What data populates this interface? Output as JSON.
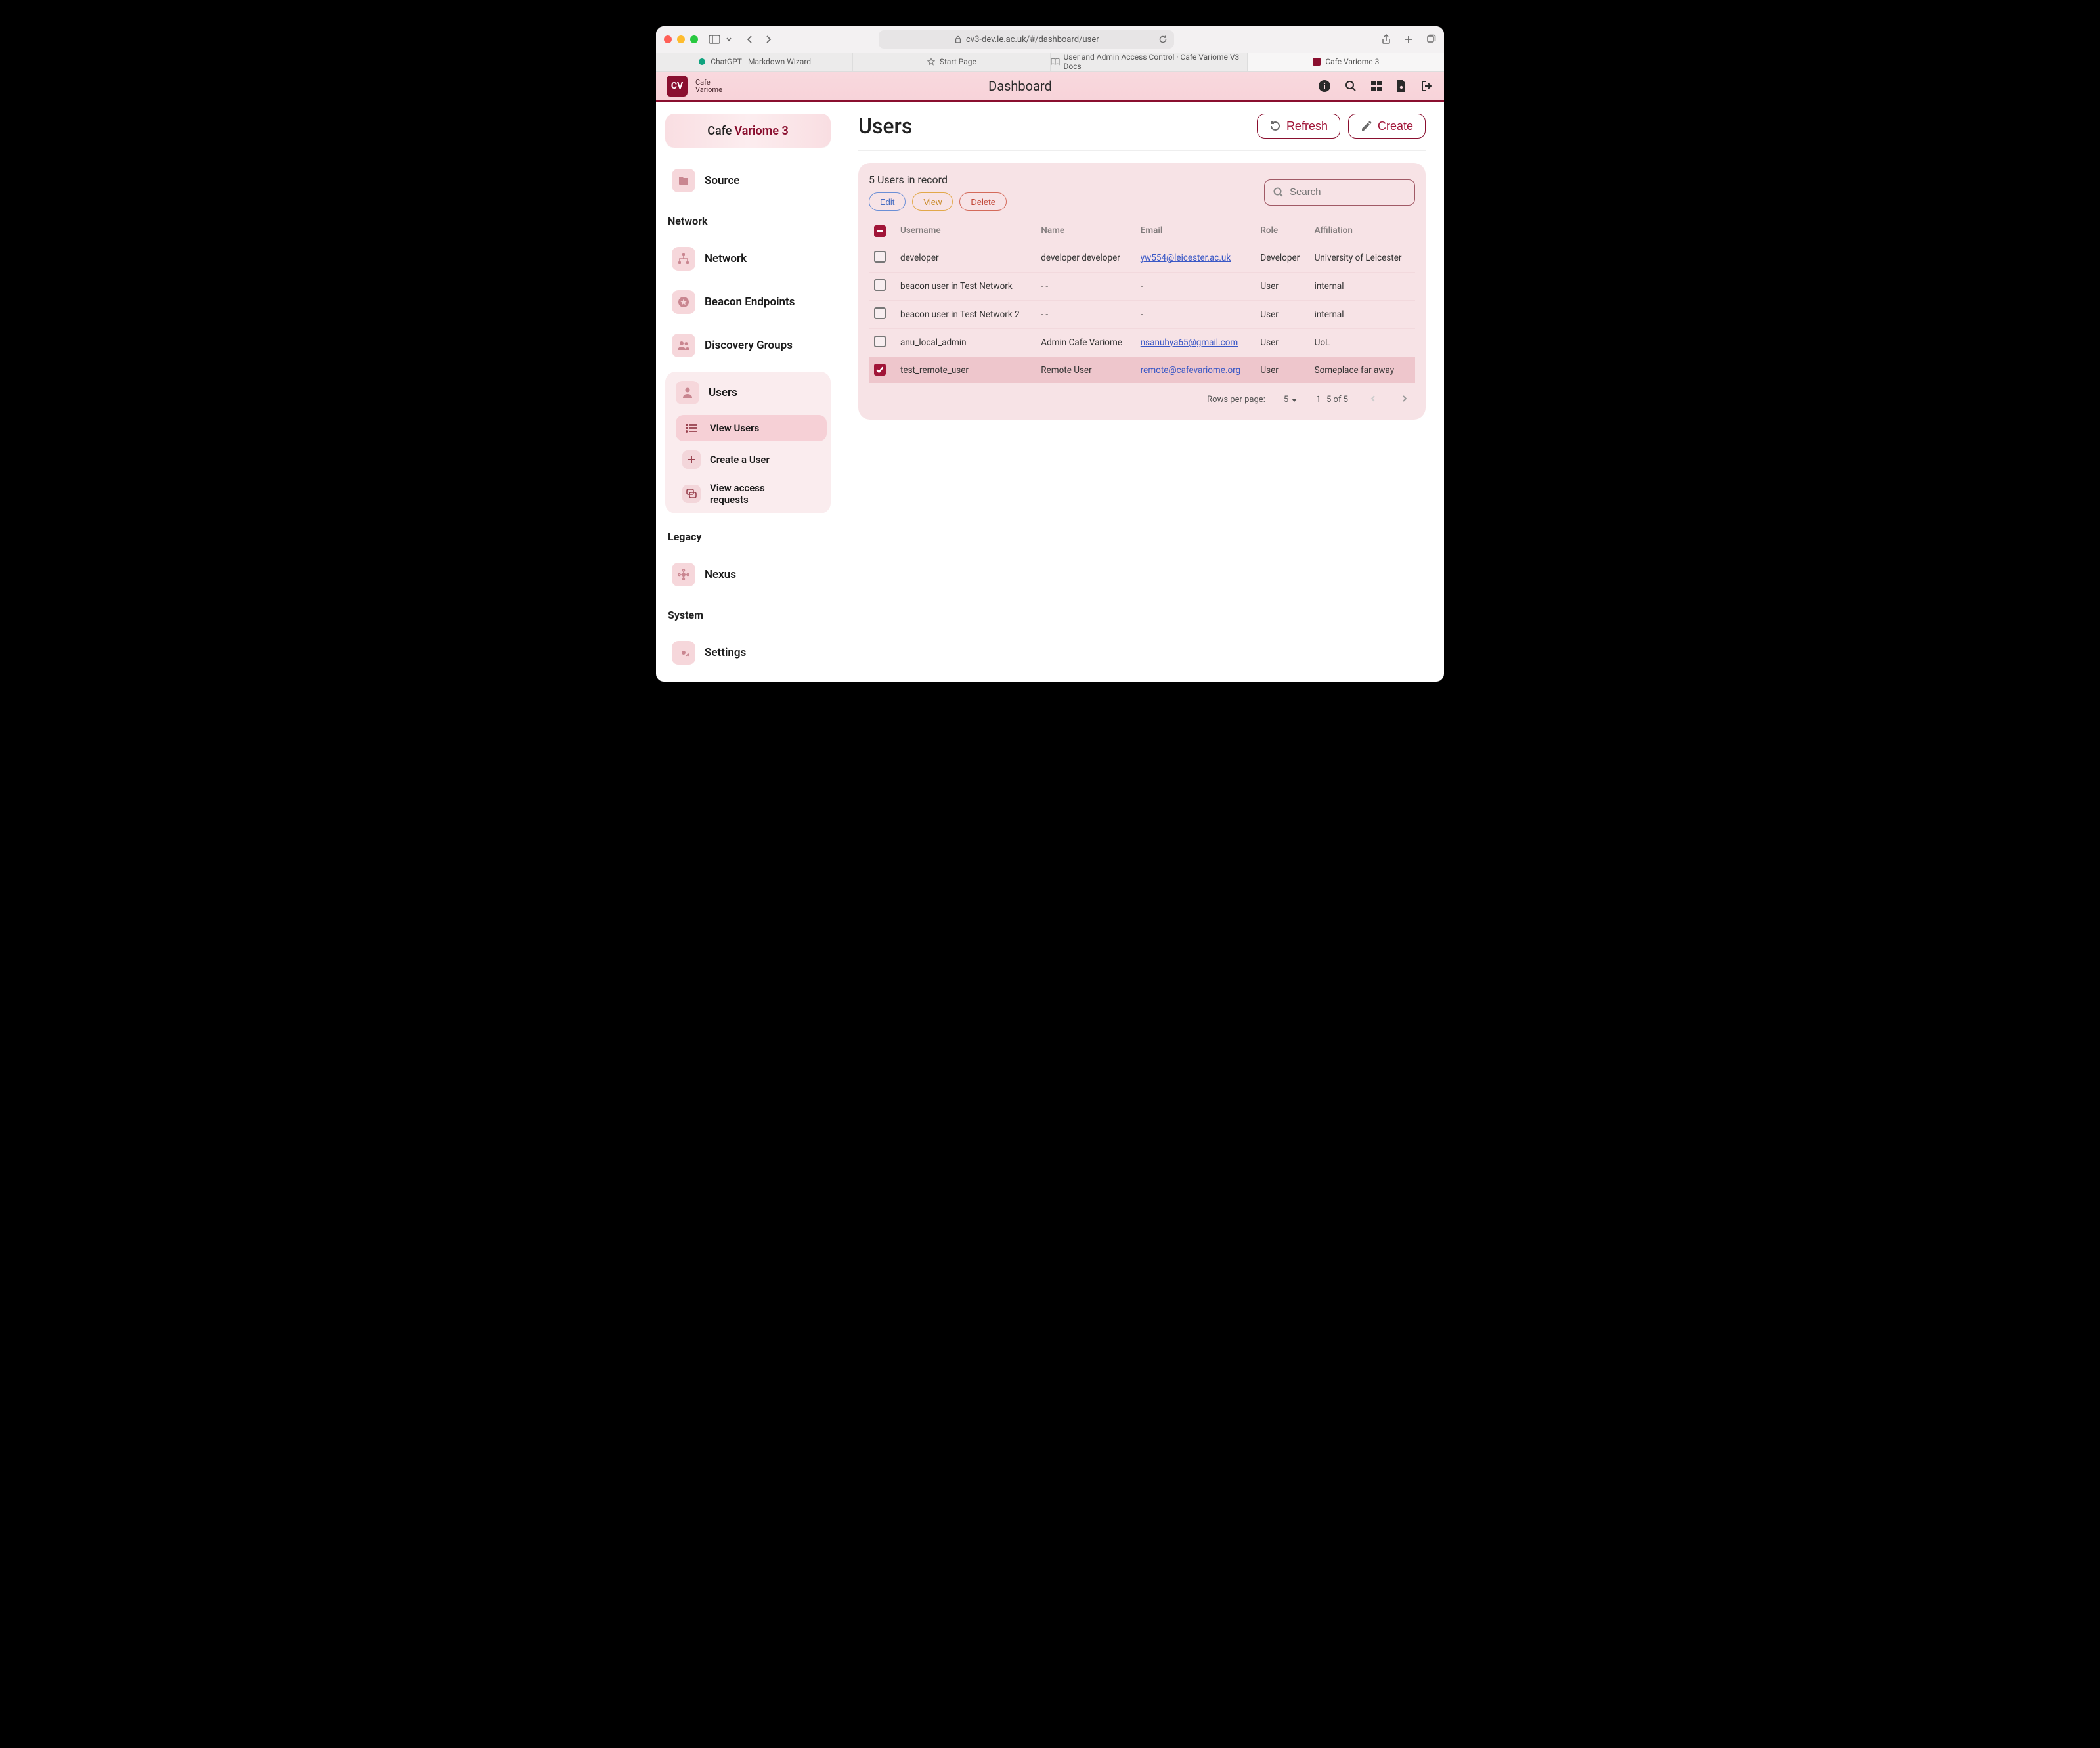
{
  "browser": {
    "url": "cv3-dev.le.ac.uk/#/dashboard/user",
    "tabs": [
      {
        "label": "ChatGPT - Markdown Wizard",
        "active": false
      },
      {
        "label": "Start Page",
        "active": false
      },
      {
        "label": "User and Admin Access Control · Cafe Variome V3 Docs",
        "active": false
      },
      {
        "label": "Cafe Variome 3",
        "active": true
      }
    ]
  },
  "header": {
    "logo_badge": "CV",
    "logo_line1": "Cafe",
    "logo_line2": "Variome",
    "title": "Dashboard"
  },
  "sidebar": {
    "brand_word1": "Cafe",
    "brand_word2": "Variome 3",
    "items": {
      "source": "Source",
      "network_section": "Network",
      "network": "Network",
      "beacon": "Beacon Endpoints",
      "discovery": "Discovery Groups",
      "users": "Users",
      "users_sub": {
        "view": "View Users",
        "create": "Create a User",
        "requests": "View access requests"
      },
      "legacy_section": "Legacy",
      "nexus": "Nexus",
      "system_section": "System",
      "settings": "Settings"
    }
  },
  "main": {
    "title": "Users",
    "refresh": "Refresh",
    "create": "Create",
    "record_count": "5 Users in record",
    "pills": {
      "edit": "Edit",
      "view": "View",
      "delete": "Delete"
    },
    "search_placeholder": "Search",
    "columns": [
      "Username",
      "Name",
      "Email",
      "Role",
      "Affiliation"
    ],
    "rows": [
      {
        "selected": false,
        "username": "developer",
        "name": "developer developer",
        "email": "yw554@leicester.ac.uk",
        "role": "Developer",
        "affiliation": "University of Leicester"
      },
      {
        "selected": false,
        "username": "beacon user in Test Network",
        "name": "- -",
        "email": "-",
        "role": "User",
        "affiliation": "internal"
      },
      {
        "selected": false,
        "username": "beacon user in Test Network 2",
        "name": "- -",
        "email": "-",
        "role": "User",
        "affiliation": "internal"
      },
      {
        "selected": false,
        "username": "anu_local_admin",
        "name": "Admin Cafe Variome",
        "email": "nsanuhya65@gmail.com",
        "role": "User",
        "affiliation": "UoL"
      },
      {
        "selected": true,
        "username": "test_remote_user",
        "name": "Remote User",
        "email": "remote@cafevariome.org",
        "role": "User",
        "affiliation": "Someplace far away"
      }
    ],
    "pager": {
      "rpp_label": "Rows per page:",
      "rpp_value": "5",
      "range": "1–5 of 5"
    }
  }
}
